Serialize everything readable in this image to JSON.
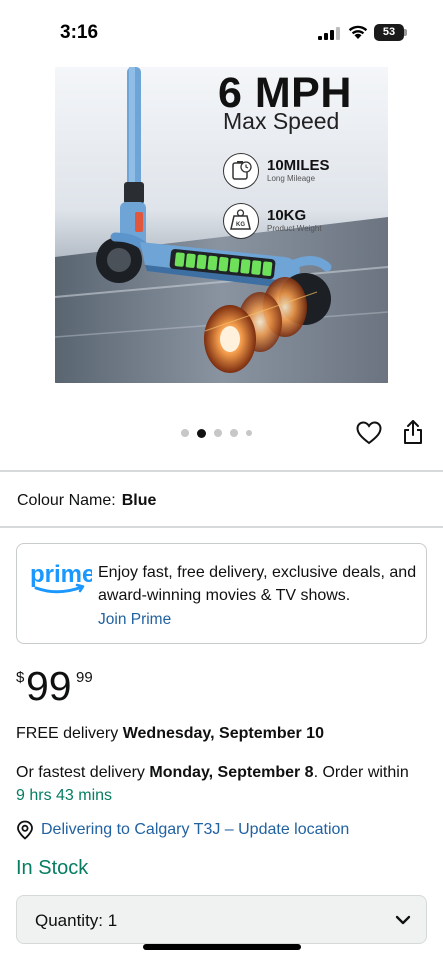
{
  "status_bar": {
    "time": "3:16",
    "battery": "53"
  },
  "product_image": {
    "headline": "6 MPH",
    "subheadline": "Max Speed",
    "specs": [
      {
        "main": "10MILES",
        "sub": "Long Mileage",
        "icon": "battery-icon"
      },
      {
        "main": "10KG",
        "sub": "Product Weight",
        "icon": "weight-icon",
        "icon_label": "KG"
      }
    ],
    "carousel_total": 5,
    "carousel_active": 2
  },
  "colour": {
    "label": "Colour Name:",
    "value": "Blue"
  },
  "prime": {
    "logo_text": "prime",
    "description": "Enjoy fast, free delivery, exclusive deals, and award-winning movies & TV shows.",
    "link": "Join Prime"
  },
  "price": {
    "symbol": "$",
    "whole": "99",
    "fraction": "99"
  },
  "delivery": {
    "prefix": "FREE delivery",
    "date": "Wednesday, September 10"
  },
  "fastest": {
    "prefix": "Or fastest delivery",
    "date": "Monday, September 8",
    "middle": ". Order within",
    "countdown": "9 hrs 43 mins"
  },
  "location": {
    "text": "Delivering to Calgary T3J – Update location"
  },
  "stock": "In Stock",
  "quantity": {
    "label": "Quantity:",
    "value": "1"
  },
  "colors": {
    "link": "#2162a1",
    "green": "#067d62",
    "prime_blue": "#1a98ff",
    "smile_orange": "#f3a847"
  }
}
